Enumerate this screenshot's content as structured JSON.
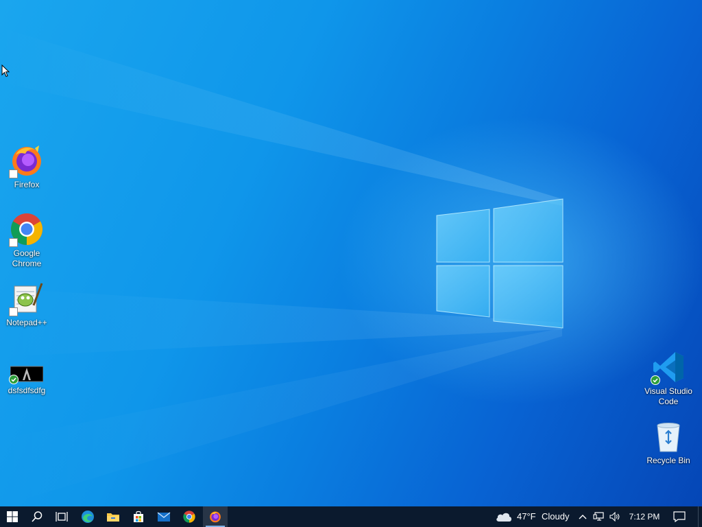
{
  "desktop": {
    "icons_left": [
      {
        "name": "firefox",
        "label": "Firefox",
        "icon": "firefox-icon"
      },
      {
        "name": "google-chrome",
        "label": "Google Chrome",
        "icon": "chrome-icon"
      },
      {
        "name": "notepad-plus-plus",
        "label": "Notepad++",
        "icon": "notepad-plus-plus-icon"
      },
      {
        "name": "dsfsdfsdfg",
        "label": "dsfsdfsdfg",
        "icon": "file-thumbnail-icon"
      }
    ],
    "icons_right": [
      {
        "name": "visual-studio-code",
        "label": "Visual Studio Code",
        "icon": "vscode-icon"
      },
      {
        "name": "recycle-bin",
        "label": "Recycle Bin",
        "icon": "recycle-bin-icon"
      }
    ]
  },
  "taskbar": {
    "buttons": [
      {
        "name": "start-button",
        "icon": "windows-logo-icon"
      },
      {
        "name": "search-button",
        "icon": "search-icon"
      },
      {
        "name": "task-view-button",
        "icon": "task-view-icon"
      },
      {
        "name": "edge-button",
        "icon": "edge-icon"
      },
      {
        "name": "file-explorer-button",
        "icon": "folder-icon"
      },
      {
        "name": "store-button",
        "icon": "store-icon"
      },
      {
        "name": "mail-button",
        "icon": "mail-icon"
      },
      {
        "name": "chrome-button",
        "icon": "chrome-icon"
      },
      {
        "name": "firefox-button",
        "icon": "firefox-icon",
        "active": true
      }
    ],
    "weather": {
      "temp": "47°F",
      "condition": "Cloudy",
      "icon": "cloud-icon"
    },
    "tray_icons": [
      "chevron-up-icon",
      "network-icon",
      "volume-icon"
    ],
    "clock": "7:12 PM",
    "notification_icon": "action-center-icon"
  },
  "colors": {
    "taskbar": "#0b1a2e",
    "desktop_blue": "#0f96ea",
    "active_indicator": "#7fb2e6"
  }
}
